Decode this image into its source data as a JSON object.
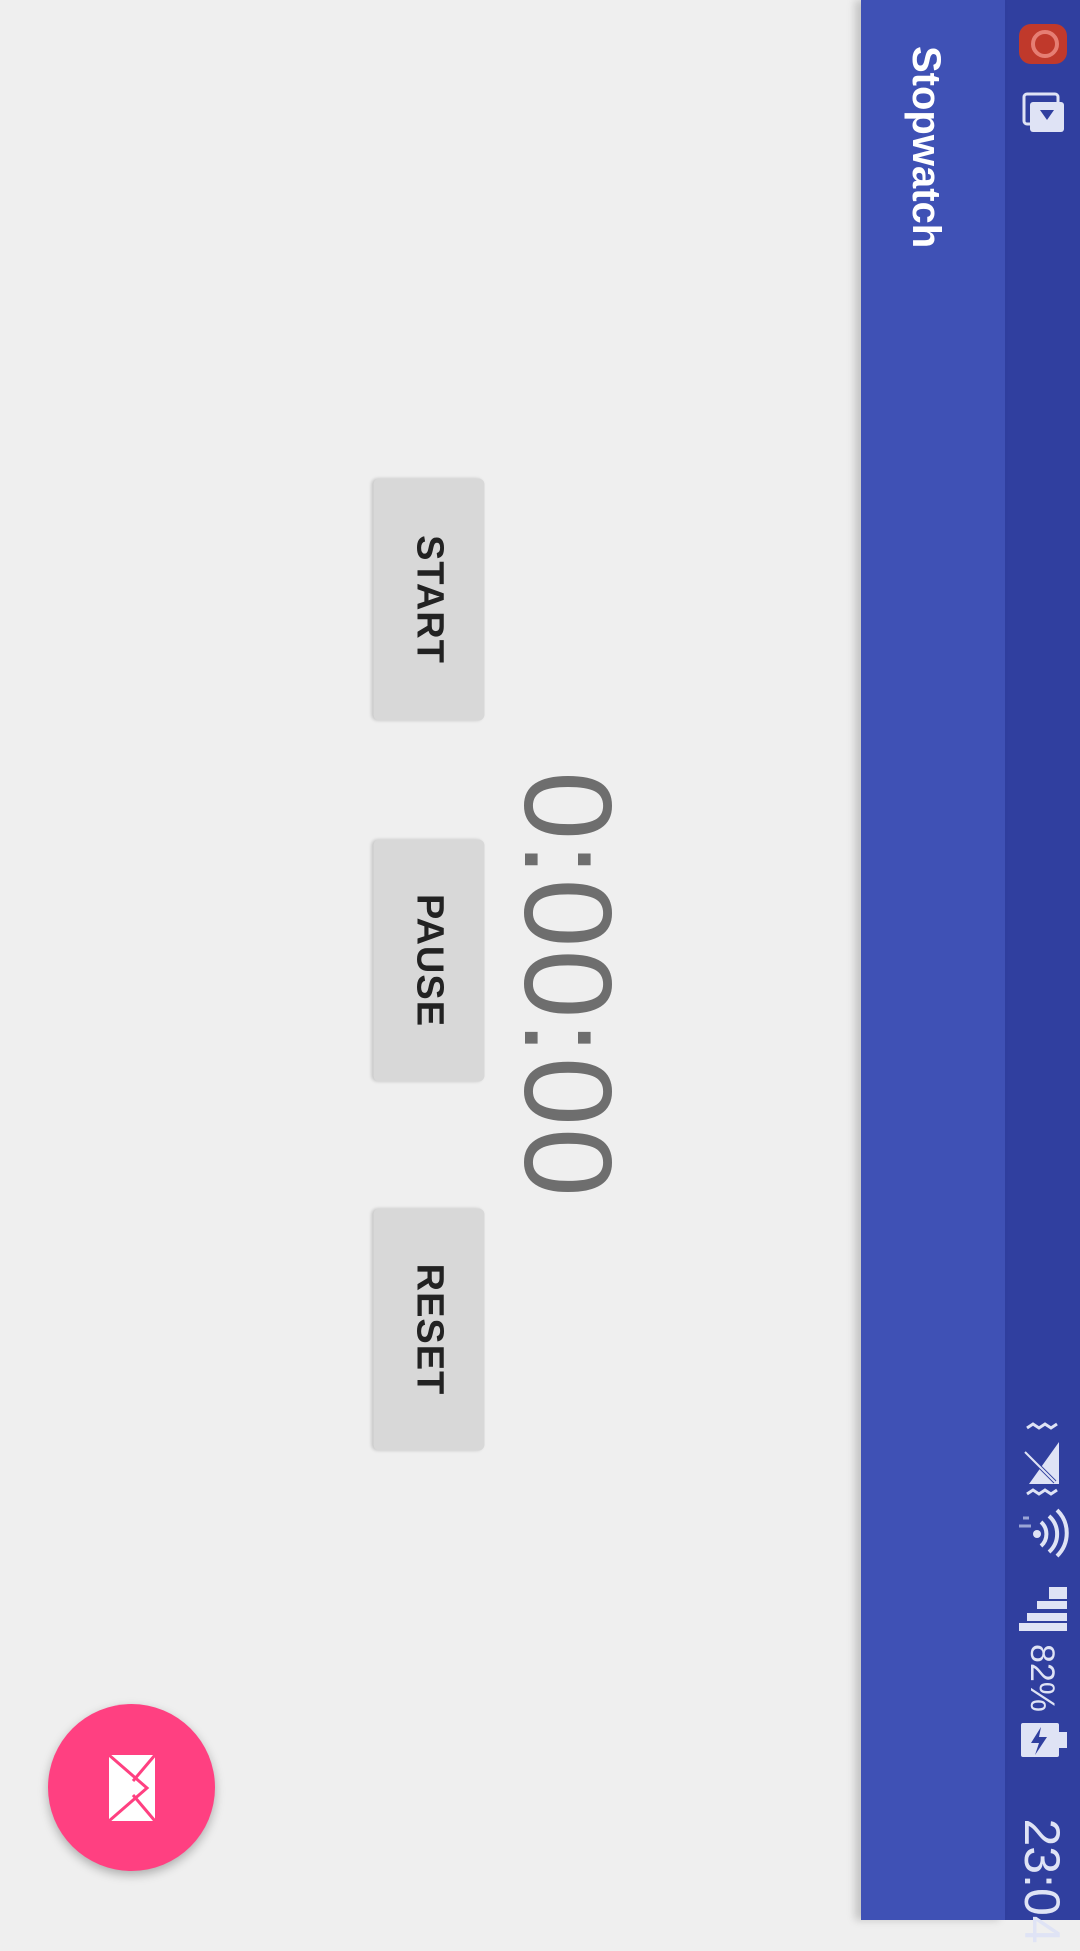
{
  "status_bar": {
    "time": "23:04",
    "battery_percent": "82%",
    "icons": [
      "app-notification-icon",
      "cast-icon",
      "vibrate-icon",
      "no-sim-icon",
      "wifi-icon",
      "signal-icon",
      "battery-charging-icon"
    ]
  },
  "app_bar": {
    "title": "Stopwatch",
    "color": "#3f51b5"
  },
  "stopwatch": {
    "time": "0:00:00"
  },
  "buttons": {
    "start": "START",
    "pause": "PAUSE",
    "reset": "RESET"
  },
  "fab": {
    "icon": "mail-icon",
    "color": "#ff4081"
  }
}
